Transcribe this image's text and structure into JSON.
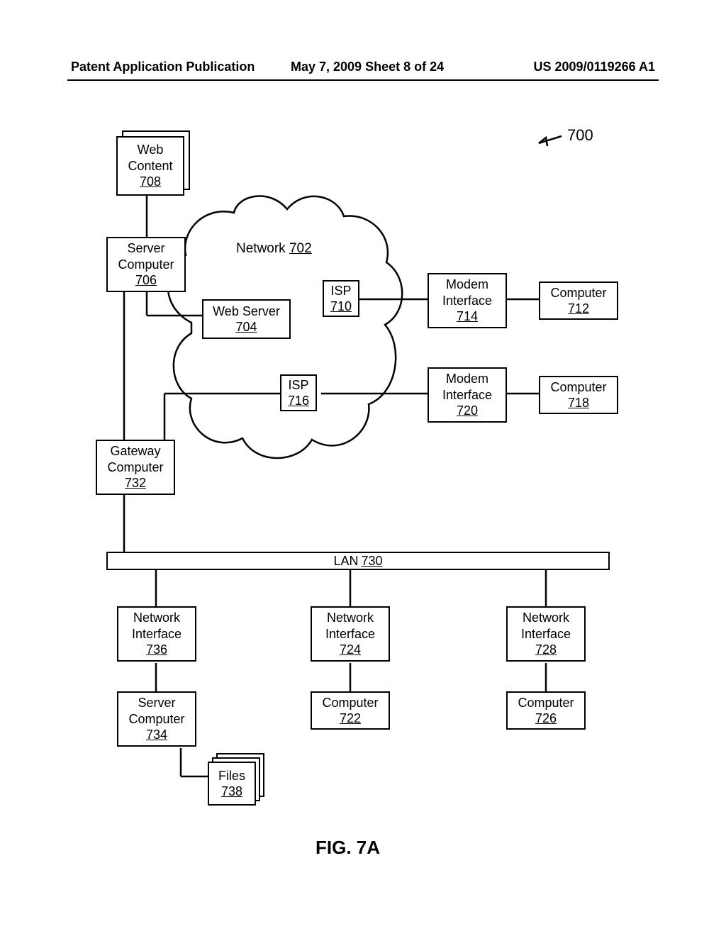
{
  "header": {
    "left": "Patent Application Publication",
    "mid": "May 7, 2009  Sheet 8 of 24",
    "right": "US 2009/0119266 A1"
  },
  "figure": {
    "ref_marker": "700",
    "caption": "FIG. 7A"
  },
  "cloud": {
    "label": "Network",
    "ref": "702"
  },
  "nodes": {
    "web_content": {
      "label": "Web Content",
      "ref": "708"
    },
    "server_706": {
      "label": "Server Computer",
      "ref": "706"
    },
    "web_server": {
      "label": "Web Server",
      "ref": "704"
    },
    "isp_710": {
      "label": "ISP",
      "ref": "710"
    },
    "isp_716": {
      "label": "ISP",
      "ref": "716"
    },
    "modem_714": {
      "label": "Modem Interface",
      "ref": "714"
    },
    "modem_720": {
      "label": "Modem Interface",
      "ref": "720"
    },
    "computer_712": {
      "label": "Computer",
      "ref": "712"
    },
    "computer_718": {
      "label": "Computer",
      "ref": "718"
    },
    "gateway_732": {
      "label": "Gateway Computer",
      "ref": "732"
    },
    "lan": {
      "label": "LAN",
      "ref": "730"
    },
    "ni_736": {
      "label": "Network Interface",
      "ref": "736"
    },
    "ni_724": {
      "label": "Network Interface",
      "ref": "724"
    },
    "ni_728": {
      "label": "Network Interface",
      "ref": "728"
    },
    "server_734": {
      "label": "Server Computer",
      "ref": "734"
    },
    "computer_722": {
      "label": "Computer",
      "ref": "722"
    },
    "computer_726": {
      "label": "Computer",
      "ref": "726"
    },
    "files_738": {
      "label": "Files",
      "ref": "738"
    }
  }
}
